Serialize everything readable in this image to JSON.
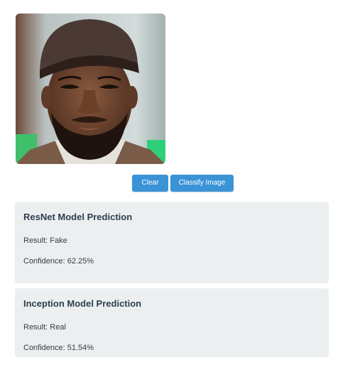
{
  "buttons": {
    "clear": "Clear",
    "classify": "Classify Image"
  },
  "predictions": [
    {
      "title": "ResNet Model Prediction",
      "result": "Result: Fake",
      "confidence": "Confidence: 62.25%"
    },
    {
      "title": "Inception Model Prediction",
      "result": "Result: Real",
      "confidence": "Confidence: 51.54%"
    }
  ],
  "colors": {
    "button": "#3b93d7",
    "card_bg": "#eceff0",
    "heading": "#2d3e4c"
  }
}
